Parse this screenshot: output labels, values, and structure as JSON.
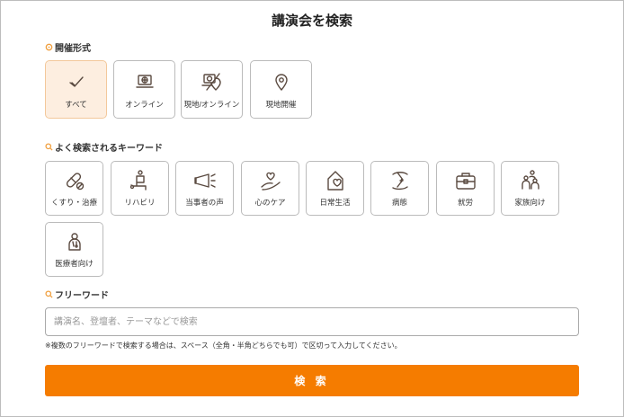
{
  "title": "講演会を検索",
  "format_section": {
    "label": "開催形式",
    "options": [
      {
        "label": "すべて",
        "icon": "check-icon",
        "selected": true
      },
      {
        "label": "オンライン",
        "icon": "laptop-globe-icon",
        "selected": false
      },
      {
        "label": "現地/オンライン",
        "icon": "laptop-location-icon",
        "selected": false
      },
      {
        "label": "現地開催",
        "icon": "location-pin-icon",
        "selected": false
      }
    ]
  },
  "keyword_section": {
    "label": "よく検索されるキーワード",
    "keywords": [
      {
        "label": "くすり・治療",
        "icon": "pill-icon"
      },
      {
        "label": "リハビリ",
        "icon": "rehabilitation-icon"
      },
      {
        "label": "当事者の声",
        "icon": "megaphone-icon"
      },
      {
        "label": "心のケア",
        "icon": "heart-hand-icon"
      },
      {
        "label": "日常生活",
        "icon": "house-heart-icon"
      },
      {
        "label": "病態",
        "icon": "pathology-icon"
      },
      {
        "label": "就労",
        "icon": "briefcase-icon"
      },
      {
        "label": "家族向け",
        "icon": "family-icon"
      },
      {
        "label": "医療者向け",
        "icon": "doctor-icon"
      }
    ]
  },
  "freeword_section": {
    "label": "フリーワード",
    "placeholder": "講演名、登壇者、テーマなどで検索",
    "value": "",
    "note": "※複数のフリーワードで検索する場合は、スペース（全角・半角どちらでも可）で区切って入力してください。"
  },
  "search_button": "検 索",
  "colors": {
    "accent": "#f57c00",
    "selected_bg": "#fdeee0",
    "icon": "#5a4a40"
  }
}
